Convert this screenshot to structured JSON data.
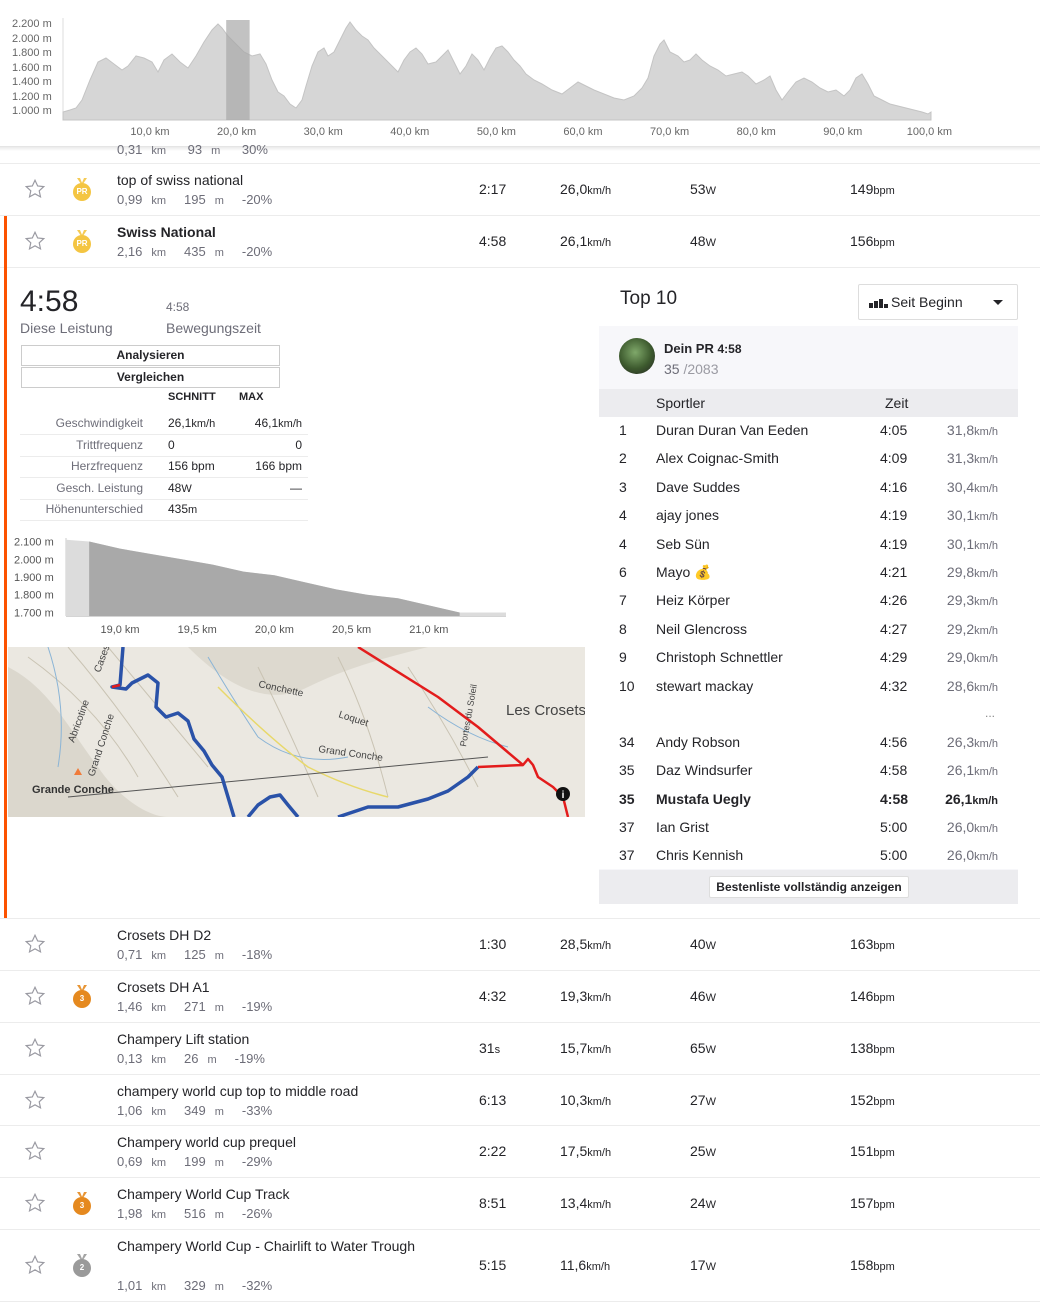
{
  "elevation_profile": {
    "y_ticks": [
      "2.200 m",
      "2.000 m",
      "1.800 m",
      "1.600 m",
      "1.400 m",
      "1.200 m",
      "1.000 m"
    ],
    "x_ticks": [
      "10,0 km",
      "20,0 km",
      "30,0 km",
      "40,0 km",
      "50,0 km",
      "60,0 km",
      "70,0 km",
      "80,0 km",
      "90,0 km",
      "100,0 km"
    ],
    "highlight_km": [
      18.8,
      21.5
    ]
  },
  "partial_row": {
    "dist": "0,31",
    "dist_u": "km",
    "elev": "93",
    "elev_u": "m",
    "grade": "30%"
  },
  "segments_above": [
    {
      "name": "top of swiss national",
      "dist": "0,99",
      "elev": "195",
      "grade": "-20%",
      "time": "2:17",
      "speed": "26,0",
      "power": "53",
      "hr": "149",
      "medal": "PR",
      "medal_type": "gold",
      "selected": false
    },
    {
      "name": "Swiss National",
      "dist": "2,16",
      "elev": "435",
      "grade": "-20%",
      "time": "4:58",
      "speed": "26,1",
      "power": "48",
      "hr": "156",
      "medal": "PR",
      "medal_type": "gold",
      "selected": true
    }
  ],
  "units": {
    "km": "km",
    "m": "m",
    "kmh": "km/h",
    "w": "W",
    "bpm": "bpm"
  },
  "detail": {
    "time": "4:58",
    "this_effort_label": "Diese Leistung",
    "moving_time": "4:58",
    "moving_time_label": "Bewegungszeit",
    "analyze_btn": "Analysieren",
    "compare_btn": "Vergleichen",
    "col_avg": "SCHNITT",
    "col_max": "MAX",
    "stats": [
      {
        "label": "Geschwindigkeit",
        "avg": "26,1",
        "avg_u": "km/h",
        "max": "46,1",
        "max_u": "km/h"
      },
      {
        "label": "Trittfrequenz",
        "avg": "0",
        "avg_u": "",
        "max": "0",
        "max_u": ""
      },
      {
        "label": "Herzfrequenz",
        "avg": "156 bpm",
        "avg_u": "",
        "max": "166 bpm",
        "max_u": ""
      },
      {
        "label": "Gesch. Leistung",
        "avg": "48",
        "avg_u": "W",
        "max": "—",
        "max_u": ""
      },
      {
        "label": "Höhenunterschied",
        "avg": "435",
        "avg_u": "m",
        "max": "",
        "max_u": ""
      }
    ],
    "mini_chart": {
      "type": "area",
      "y_ticks": [
        "2.100 m",
        "2.000 m",
        "1.900 m",
        "1.800 m",
        "1.700 m"
      ],
      "x_ticks": [
        "19,0 km",
        "19,5 km",
        "20,0 km",
        "20,5 km",
        "21,0 km"
      ],
      "x": [
        18.65,
        18.8,
        19.0,
        19.2,
        19.4,
        19.6,
        19.8,
        20.0,
        20.2,
        20.4,
        20.6,
        20.8,
        21.0,
        21.2,
        21.5
      ],
      "y": [
        2110,
        2100,
        2060,
        2030,
        2000,
        1970,
        1930,
        1910,
        1870,
        1830,
        1800,
        1780,
        1740,
        1700,
        1700
      ],
      "highlight": [
        18.8,
        21.2
      ]
    },
    "map": {
      "labels": [
        "Grande Conche",
        "Abricotine",
        "Grand Conche",
        "Conchette",
        "Loquet",
        "Grand Conche",
        "Portes du Soleil",
        "Les Crosets",
        "Cases"
      ]
    }
  },
  "leaderboard": {
    "title": "Top 10",
    "filter": "Seit Beginn",
    "pr_label": "Dein PR",
    "pr_time": "4:58",
    "rank": "35",
    "total": "/2083",
    "col_athlete": "Sportler",
    "col_time": "Zeit",
    "rows": [
      {
        "rank": "1",
        "name": "Duran Duran Van Eeden",
        "time": "4:05",
        "speed": "31,8"
      },
      {
        "rank": "2",
        "name": "Alex Coignac-Smith",
        "time": "4:09",
        "speed": "31,3"
      },
      {
        "rank": "3",
        "name": "Dave Suddes",
        "time": "4:16",
        "speed": "30,4"
      },
      {
        "rank": "4",
        "name": "ajay jones",
        "time": "4:19",
        "speed": "30,1"
      },
      {
        "rank": "4",
        "name": "Seb Sün",
        "time": "4:19",
        "speed": "30,1"
      },
      {
        "rank": "6",
        "name": "Mayo 💰",
        "time": "4:21",
        "speed": "29,8"
      },
      {
        "rank": "7",
        "name": "Heiz Körper",
        "time": "4:26",
        "speed": "29,3"
      },
      {
        "rank": "8",
        "name": "Neil Glencross",
        "time": "4:27",
        "speed": "29,2"
      },
      {
        "rank": "9",
        "name": "Christoph Schnettler",
        "time": "4:29",
        "speed": "29,0"
      },
      {
        "rank": "10",
        "name": "stewart mackay",
        "time": "4:32",
        "speed": "28,6"
      }
    ],
    "ellipsis": "...",
    "rows_near": [
      {
        "rank": "34",
        "name": "Andy Robson",
        "time": "4:56",
        "speed": "26,3",
        "me": false
      },
      {
        "rank": "35",
        "name": "Daz Windsurfer",
        "time": "4:58",
        "speed": "26,1",
        "me": false
      },
      {
        "rank": "35",
        "name": "Mustafa Uegly",
        "time": "4:58",
        "speed": "26,1",
        "me": true
      },
      {
        "rank": "37",
        "name": "Ian Grist",
        "time": "5:00",
        "speed": "26,0",
        "me": false
      },
      {
        "rank": "37",
        "name": "Chris Kennish",
        "time": "5:00",
        "speed": "26,0",
        "me": false
      }
    ],
    "full_btn": "Bestenliste vollständig anzeigen"
  },
  "segments_below": [
    {
      "name": "Crosets DH D2",
      "dist": "0,71",
      "elev": "125",
      "grade": "-18%",
      "time": "1:30",
      "speed": "28,5",
      "power": "40",
      "hr": "163",
      "medal": "",
      "medal_type": ""
    },
    {
      "name": "Crosets DH A1",
      "dist": "1,46",
      "elev": "271",
      "grade": "-19%",
      "time": "4:32",
      "speed": "19,3",
      "power": "46",
      "hr": "146",
      "medal": "3",
      "medal_type": "bronze"
    },
    {
      "name": "Champery Lift station",
      "dist": "0,13",
      "elev": "26",
      "grade": "-19%",
      "time": "31",
      "time_u": "s",
      "speed": "15,7",
      "power": "65",
      "hr": "138",
      "medal": "",
      "medal_type": ""
    },
    {
      "name": "champery world cup top to middle road",
      "dist": "1,06",
      "elev": "349",
      "grade": "-33%",
      "time": "6:13",
      "speed": "10,3",
      "power": "27",
      "hr": "152",
      "medal": "",
      "medal_type": ""
    },
    {
      "name": "Champery world cup prequel",
      "dist": "0,69",
      "elev": "199",
      "grade": "-29%",
      "time": "2:22",
      "speed": "17,5",
      "power": "25",
      "hr": "151",
      "medal": "",
      "medal_type": ""
    },
    {
      "name": "Champery World Cup Track",
      "dist": "1,98",
      "elev": "516",
      "grade": "-26%",
      "time": "8:51",
      "speed": "13,4",
      "power": "24",
      "hr": "157",
      "medal": "3",
      "medal_type": "bronze"
    },
    {
      "name": "Champery World Cup - Chairlift to Water Trough",
      "dist": "1,01",
      "elev": "329",
      "grade": "-32%",
      "time": "5:15",
      "speed": "11,6",
      "power": "17",
      "hr": "158",
      "medal": "2",
      "medal_type": "silver"
    }
  ]
}
